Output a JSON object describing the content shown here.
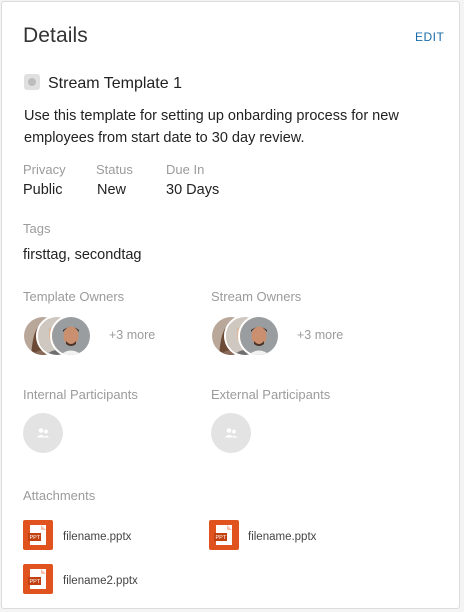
{
  "header": {
    "title": "Details",
    "edit_label": "EDIT"
  },
  "template": {
    "name": "Stream Template 1",
    "description": "Use this template for setting up onbarding process for new employees from start date to 30 day review."
  },
  "meta": {
    "privacy": {
      "label": "Privacy",
      "value": "Public"
    },
    "status": {
      "label": "Status",
      "value": "New"
    },
    "due": {
      "label": "Due In",
      "value": "30 Days"
    }
  },
  "tags": {
    "label": "Tags",
    "value": "firsttag, secondtag"
  },
  "owners": {
    "template": {
      "label": "Template Owners",
      "more": "+3 more"
    },
    "stream": {
      "label": "Stream Owners",
      "more": "+3 more"
    }
  },
  "participants": {
    "internal": {
      "label": "Internal Participants",
      "icon": "group-icon"
    },
    "external": {
      "label": "External Participants",
      "icon": "group-icon"
    }
  },
  "attachments": {
    "label": "Attachments",
    "files": [
      {
        "name": "filename.pptx",
        "icon": "pptx-file-icon"
      },
      {
        "name": "filename.pptx",
        "icon": "pptx-file-icon"
      },
      {
        "name": "filename2.pptx",
        "icon": "pptx-file-icon"
      }
    ]
  },
  "colors": {
    "accent": "#1b6ca8",
    "file_icon": "#e0531f",
    "muted": "#9b9b9b"
  }
}
